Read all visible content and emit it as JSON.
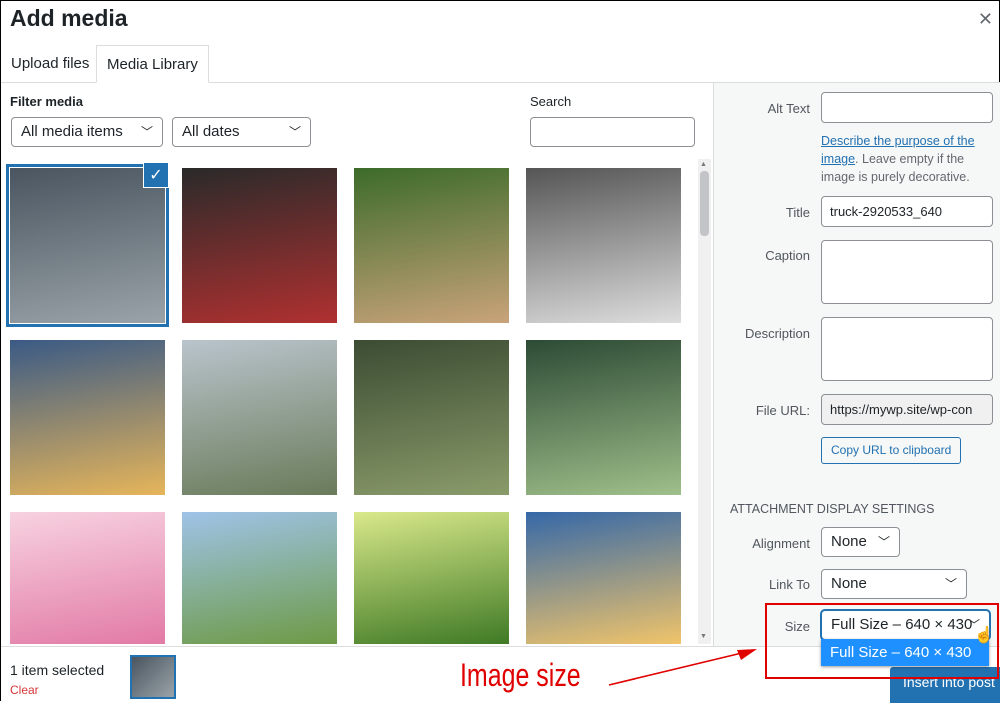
{
  "modal": {
    "title": "Add media",
    "close_icon": "close-icon"
  },
  "tabs": [
    {
      "label": "Upload files"
    },
    {
      "label": "Media Library",
      "active": true
    }
  ],
  "filter": {
    "label": "Filter media",
    "type_value": "All media items",
    "date_value": "All dates",
    "search_label": "Search",
    "search_value": ""
  },
  "grid": {
    "thumbnails": [
      {
        "subject": "truck wheels",
        "selected": true,
        "colors": [
          "#4a5560",
          "#9aa3a8"
        ]
      },
      {
        "subject": "car engine",
        "colors": [
          "#2a2a2a",
          "#b03030"
        ]
      },
      {
        "subject": "forest path",
        "colors": [
          "#3c6b2a",
          "#c9a37a"
        ]
      },
      {
        "subject": "mountain lake bw",
        "colors": [
          "#555",
          "#ddd"
        ]
      },
      {
        "subject": "sunset over mountains",
        "colors": [
          "#3a5a85",
          "#e6b55a"
        ]
      },
      {
        "subject": "snowy mountains stone path",
        "colors": [
          "#b9c4cc",
          "#6a7b5a"
        ]
      },
      {
        "subject": "green valley clouds",
        "colors": [
          "#3b4c33",
          "#8a9b6a"
        ]
      },
      {
        "subject": "misty forest",
        "colors": [
          "#2d4a35",
          "#9fbf8a"
        ]
      },
      {
        "subject": "pink blossoms",
        "colors": [
          "#f7d2e0",
          "#e27aa6"
        ]
      },
      {
        "subject": "butterflies flowers",
        "colors": [
          "#9fc3e8",
          "#6d9a45"
        ]
      },
      {
        "subject": "meadow daisies sunlight",
        "colors": [
          "#d9e88a",
          "#3f7a25"
        ]
      },
      {
        "subject": "sunrays over mountains",
        "colors": [
          "#3568a8",
          "#f0c46a"
        ]
      }
    ]
  },
  "details": {
    "alt_text_label": "Alt Text",
    "alt_text_value": "",
    "alt_help_link": "Describe the purpose of the image",
    "alt_help_text": ". Leave empty if the image is purely decorative.",
    "title_label": "Title",
    "title_value": "truck-2920533_640",
    "caption_label": "Caption",
    "caption_value": "",
    "description_label": "Description",
    "description_value": "",
    "file_url_label": "File URL:",
    "file_url_value": "https://mywp.site/wp-con",
    "copy_url_label": "Copy URL to clipboard"
  },
  "display_settings": {
    "heading": "ATTACHMENT DISPLAY SETTINGS",
    "alignment_label": "Alignment",
    "alignment_value": "None",
    "link_to_label": "Link To",
    "link_to_value": "None",
    "size_label": "Size",
    "size_value": "Full Size – 640 × 430",
    "size_options": [
      "Full Size – 640 × 430"
    ]
  },
  "toolbar": {
    "selected_count": "1 item selected",
    "clear_label": "Clear",
    "insert_label": "Insert into post"
  },
  "annotation": {
    "text": "Image size",
    "color": "#e00000"
  },
  "colors": {
    "accent": "#2271b1",
    "link": "#2271b1",
    "highlight_option": "#1e90ff"
  }
}
